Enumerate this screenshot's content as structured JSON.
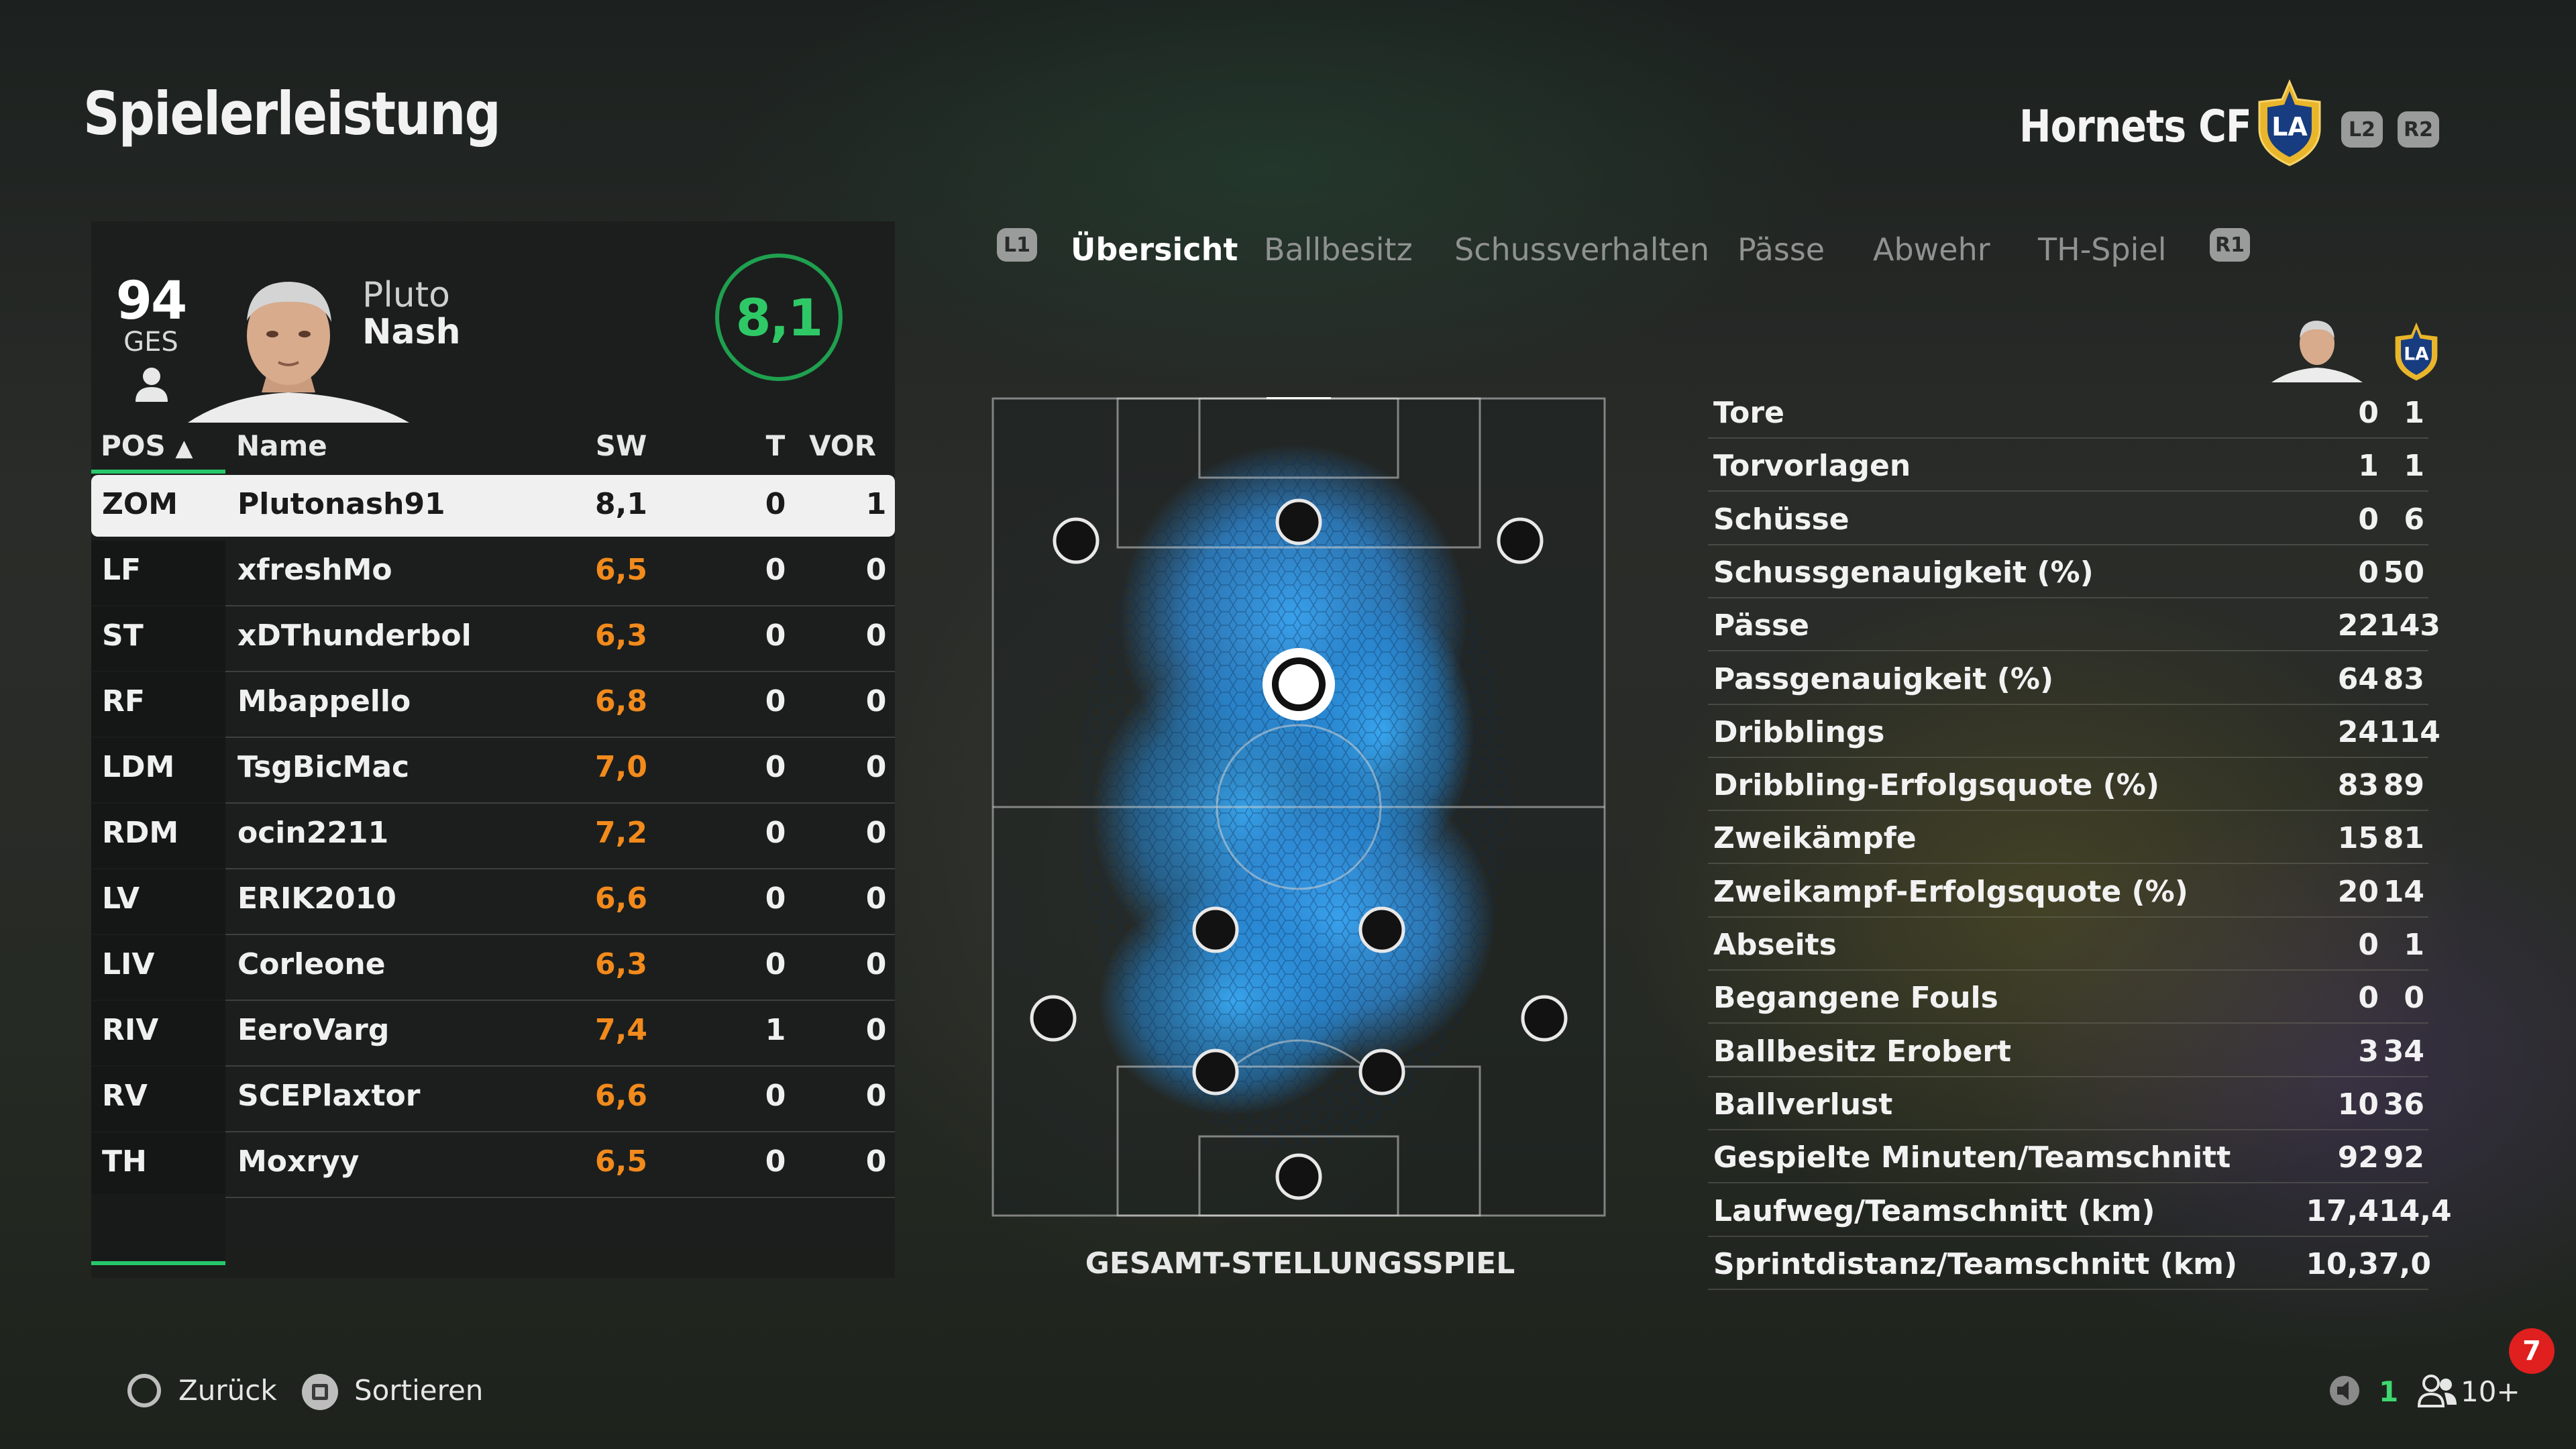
{
  "header": {
    "title": "Spielerleistung",
    "team_name": "Hornets CF",
    "team_badge_text": "LA",
    "left_bumper": "L2",
    "right_bumper": "R2"
  },
  "player_card": {
    "overall": "94",
    "overall_label": "GES",
    "first_name": "Pluto",
    "last_name": "Nash",
    "match_rating": "8,1"
  },
  "table": {
    "headers": {
      "pos": "POS",
      "sort_arrow": "▲",
      "name": "Name",
      "sw": "SW",
      "t": "T",
      "vor": "VOR"
    },
    "rows": [
      {
        "pos": "ZOM",
        "name": "Plutonash91",
        "sw": "8,1",
        "t": "0",
        "vor": "1"
      },
      {
        "pos": "LF",
        "name": "xfreshMo",
        "sw": "6,5",
        "t": "0",
        "vor": "0"
      },
      {
        "pos": "ST",
        "name": "xDThunderbol",
        "sw": "6,3",
        "t": "0",
        "vor": "0"
      },
      {
        "pos": "RF",
        "name": "Mbappello",
        "sw": "6,8",
        "t": "0",
        "vor": "0"
      },
      {
        "pos": "LDM",
        "name": "TsgBicMac",
        "sw": "7,0",
        "t": "0",
        "vor": "0"
      },
      {
        "pos": "RDM",
        "name": "ocin2211",
        "sw": "7,2",
        "t": "0",
        "vor": "0"
      },
      {
        "pos": "LV",
        "name": "ERIK2010",
        "sw": "6,6",
        "t": "0",
        "vor": "0"
      },
      {
        "pos": "LIV",
        "name": "Corleone",
        "sw": "6,3",
        "t": "0",
        "vor": "0"
      },
      {
        "pos": "RIV",
        "name": "EeroVarg",
        "sw": "7,4",
        "t": "1",
        "vor": "0"
      },
      {
        "pos": "RV",
        "name": "SCEPlaxtor",
        "sw": "6,6",
        "t": "0",
        "vor": "0"
      },
      {
        "pos": "TH",
        "name": "Moxryy",
        "sw": "6,5",
        "t": "0",
        "vor": "0"
      }
    ]
  },
  "tabs": {
    "left_bumper": "L1",
    "right_bumper": "R1",
    "items": [
      {
        "label": "Übersicht"
      },
      {
        "label": "Ballbesitz"
      },
      {
        "label": "Schussverhalten"
      },
      {
        "label": "Pässe"
      },
      {
        "label": "Abwehr"
      },
      {
        "label": "TH-Spiel"
      }
    ]
  },
  "pitch": {
    "caption": "GESAMT-STELLUNGSSPIEL",
    "heat_color": "#2f9cf0"
  },
  "stats": {
    "team_badge_text": "LA",
    "rows": [
      {
        "label": "Tore",
        "player": "0",
        "team": "1"
      },
      {
        "label": "Torvorlagen",
        "player": "1",
        "team": "1"
      },
      {
        "label": "Schüsse",
        "player": "0",
        "team": "6"
      },
      {
        "label": "Schussgenauigkeit (%)",
        "player": "0",
        "team": "50"
      },
      {
        "label": "Pässe",
        "player": "22",
        "team": "143"
      },
      {
        "label": "Passgenauigkeit (%)",
        "player": "64",
        "team": "83"
      },
      {
        "label": "Dribblings",
        "player": "24",
        "team": "114"
      },
      {
        "label": "Dribbling-Erfolgsquote (%)",
        "player": "83",
        "team": "89"
      },
      {
        "label": "Zweikämpfe",
        "player": "15",
        "team": "81"
      },
      {
        "label": "Zweikampf-Erfolgsquote (%)",
        "player": "20",
        "team": "14"
      },
      {
        "label": "Abseits",
        "player": "0",
        "team": "1"
      },
      {
        "label": "Begangene Fouls",
        "player": "0",
        "team": "0"
      },
      {
        "label": "Ballbesitz Erobert",
        "player": "3",
        "team": "34"
      },
      {
        "label": "Ballverlust",
        "player": "10",
        "team": "36"
      },
      {
        "label": "Gespielte Minuten/Teamschnitt",
        "player": "92",
        "team": "92"
      },
      {
        "label": "Laufweg/Teamschnitt (km)",
        "player": "17,4",
        "team": "14,4"
      },
      {
        "label": "Sprintdistanz/Teamschnitt (km)",
        "player": "10,3",
        "team": "7,0"
      }
    ]
  },
  "footer": {
    "back_label": "Zurück",
    "sort_label": "Sortieren",
    "voice_count": "1",
    "party_count": "10+",
    "notification_count": "7"
  },
  "colors": {
    "accent_green": "#27c86b",
    "rating_orange": "#f28a1c",
    "heat_blue": "#2f9cf0",
    "notification_red": "#e01f1f"
  }
}
